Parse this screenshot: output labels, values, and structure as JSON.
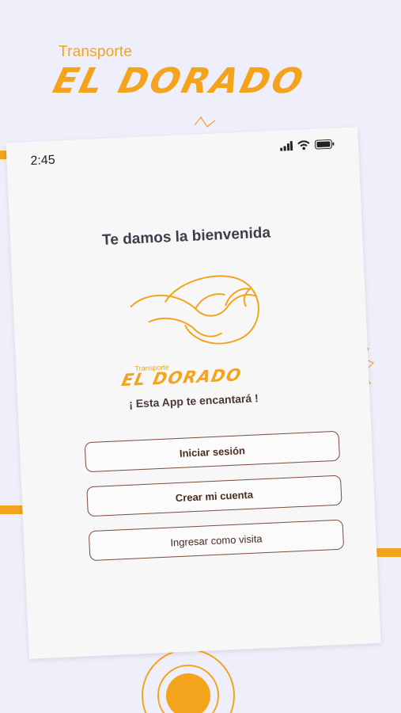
{
  "colors": {
    "accent": "#f3a41c",
    "background": "#efeffb",
    "button_border": "#7b4a3e",
    "text_dark": "#3a3f4a"
  },
  "brand": {
    "small": "Transporte",
    "big": "EL DORADO"
  },
  "status_bar": {
    "time": "2:45",
    "icons": [
      "signal-icon",
      "wifi-icon",
      "battery-icon"
    ]
  },
  "welcome": "Te damos la bienvenida",
  "logo": {
    "small": "Transporte",
    "big": "EL DORADO"
  },
  "tagline": "¡ Esta App te encantará !",
  "buttons": {
    "login": "Iniciar sesión",
    "create": "Crear mi cuenta",
    "guest": "Ingresar como visita"
  }
}
